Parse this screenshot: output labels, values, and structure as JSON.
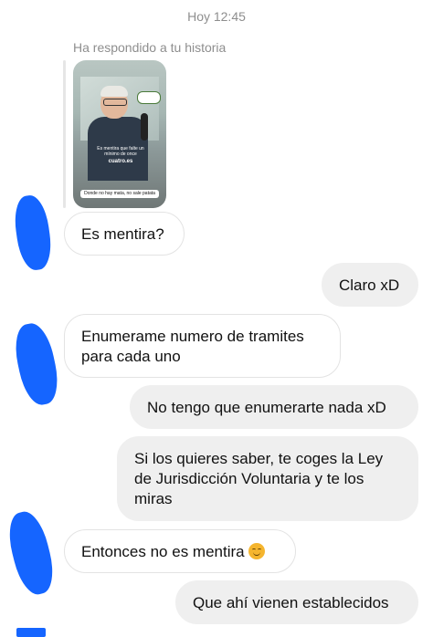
{
  "header": {
    "timestamp": "Hoy 12:45"
  },
  "story_reply": {
    "label": "Ha respondido a tu historia",
    "thumbnail": {
      "overlay_text": "Es mentira que falte un mínimo de once",
      "overlay_brand": "cuatro.es",
      "caption": "Donde no hay mata, no sale patata"
    }
  },
  "messages": [
    {
      "side": "incoming",
      "text": "Es mentira?"
    },
    {
      "side": "outgoing",
      "text": "Claro xD"
    },
    {
      "side": "incoming",
      "lines": [
        "Enumerame numero de tramites",
        "para cada uno"
      ]
    },
    {
      "side": "outgoing",
      "text": "No tengo que enumerarte nada xD"
    },
    {
      "side": "outgoing",
      "lines": [
        "Si los quieres saber, te coges la Ley",
        "de Jurisdicción Voluntaria y te los",
        "miras"
      ]
    },
    {
      "side": "incoming",
      "text": "Entonces no es mentira",
      "emoji": "smiling-face-icon"
    },
    {
      "side": "outgoing",
      "text": "Que ahí vienen establecidos"
    }
  ],
  "colors": {
    "incoming_bubble_bg": "#ffffff",
    "outgoing_bubble_bg": "#efefef",
    "redaction": "#1565ff",
    "meta_text": "#8e8e8e"
  }
}
